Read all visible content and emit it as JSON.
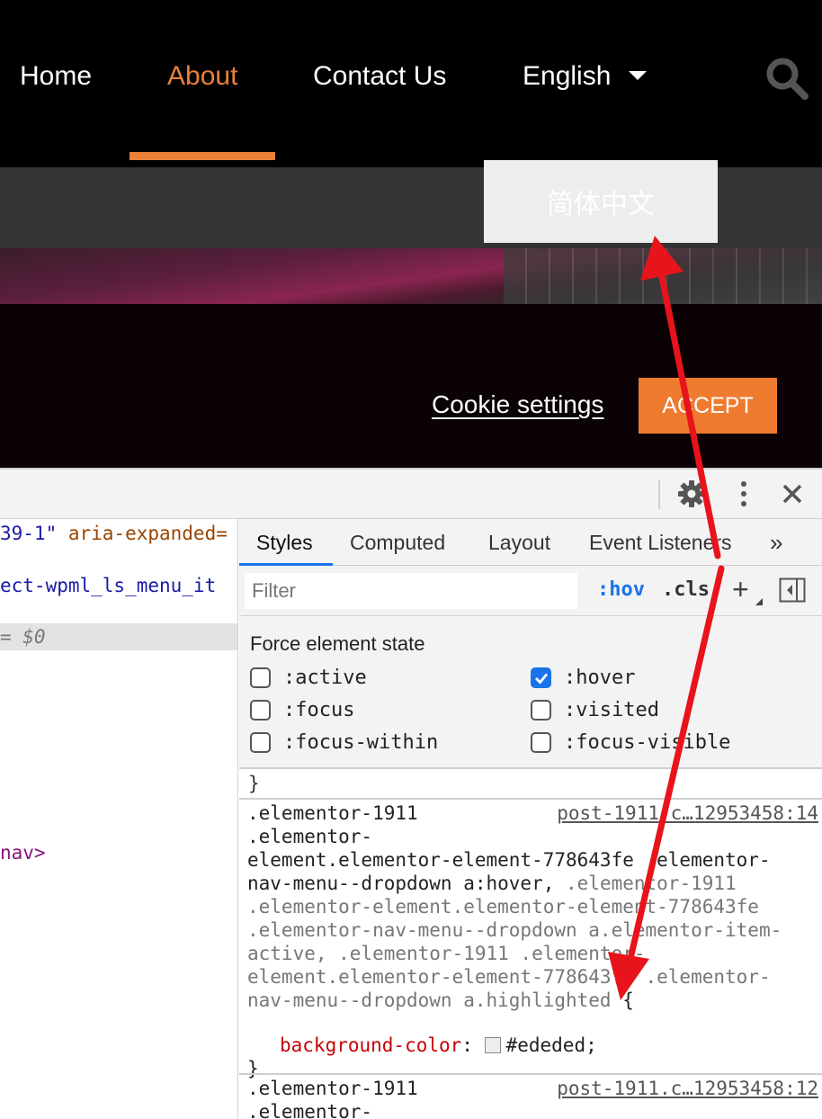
{
  "site": {
    "nav": {
      "home": "Home",
      "about": "About",
      "contact": "Contact Us",
      "language": "English"
    },
    "dropdown_item": "简体中文",
    "cookie_settings": "Cookie settings",
    "accept": "ACCEPT",
    "colors": {
      "accent": "#e9813a",
      "accept_bg": "#ee7b30",
      "dropdown_bg": "#ededed"
    }
  },
  "devtools": {
    "elements": {
      "line1_str": "39-1\"",
      "line1_attr": " aria-expanded=",
      "line2": "ect-wpml_ls_menu_it",
      "line3": "= $0",
      "line4": "nav>"
    },
    "tabs": {
      "styles": "Styles",
      "computed": "Computed",
      "layout": "Layout",
      "events": "Event Listeners",
      "more": "»"
    },
    "filter_placeholder": "Filter",
    "hov": ":hov",
    "cls": ".cls",
    "plus": "+",
    "force_state": {
      "title": "Force element state",
      "active": ":active",
      "hover": ":hover",
      "focus": ":focus",
      "visited": ":visited",
      "focus_within": ":focus-within",
      "focus_visible": ":focus-visible"
    },
    "rule_close": "}",
    "rule1": {
      "source": "post-1911.c…12953458:14",
      "l1": ".elementor-1911",
      "l2": ".elementor-",
      "l3": "element.elementor-element-778643fe .elementor-",
      "l4a": "nav-menu--dropdown a:hover,",
      "l4b": " .elementor-1911",
      "l5": ".elementor-element.elementor-element-778643fe",
      "l6": ".elementor-nav-menu--dropdown a.elementor-item-",
      "l7": "active, .elementor-1911 .elementor-",
      "l8": "element.elementor-element-778643fe .elementor-",
      "l9": "nav-menu--dropdown a.highlighted",
      "open": " {",
      "prop": "background-color",
      "value": "#ededed;",
      "close": "}"
    },
    "rule2": {
      "source": "post-1911.c…12953458:12",
      "l1": ".elementor-1911",
      "l2": ".elementor-"
    }
  }
}
